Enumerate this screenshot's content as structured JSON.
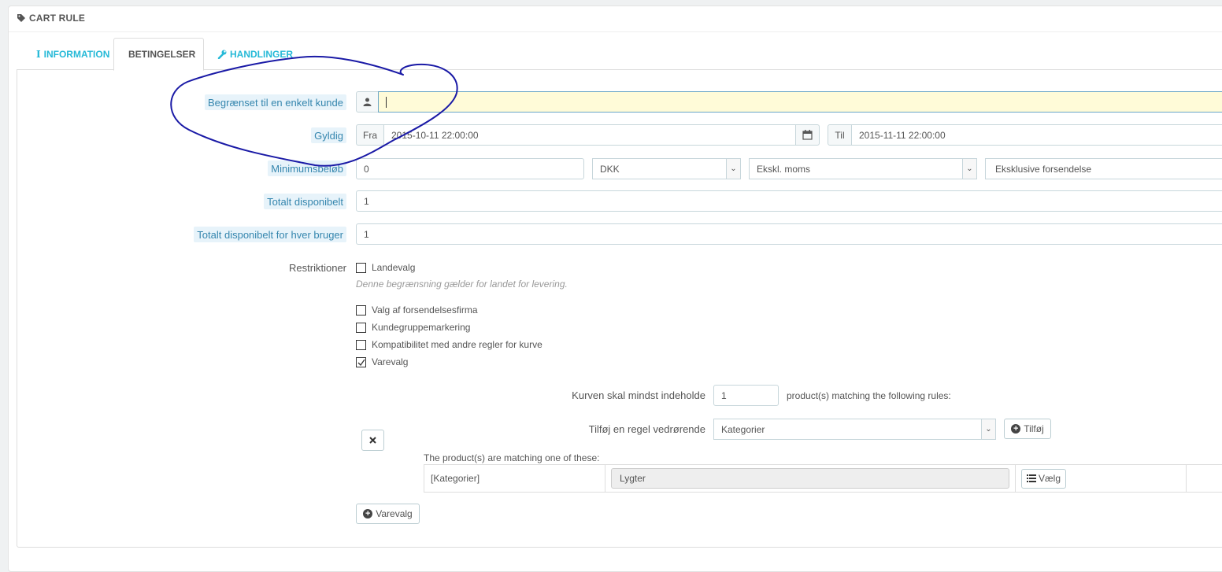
{
  "panel": {
    "title": "CART RULE",
    "icon": "tag-icon"
  },
  "tabs": [
    {
      "label": "INFORMATION",
      "icon": "info-icon",
      "active": false
    },
    {
      "label": "BETINGELSER",
      "icon": "shuffle-icon",
      "active": true
    },
    {
      "label": "HANDLINGER",
      "icon": "wrench-icon",
      "active": false
    }
  ],
  "form": {
    "customer": {
      "label": "Begrænset til en enkelt kunde",
      "value": ""
    },
    "valid": {
      "label": "Gyldig",
      "from_label": "Fra",
      "from_value": "2015-10-11 22:00:00",
      "to_label": "Til",
      "to_value": "2015-11-11 22:00:00"
    },
    "minimum": {
      "label": "Minimumsbeløb",
      "amount": "0",
      "currency": "DKK",
      "tax": "Ekskl. moms",
      "shipping": "Eksklusive forsendelse"
    },
    "total_available": {
      "label": "Totalt disponibelt",
      "value": "1"
    },
    "total_per_user": {
      "label": "Totalt disponibelt for hver bruger",
      "value": "1"
    },
    "restrictions": {
      "label": "Restriktioner",
      "country": {
        "label": "Landevalg",
        "checked": false
      },
      "country_help": "Denne begrænsning gælder for landet for levering.",
      "carrier": {
        "label": "Valg af forsendelsesfirma",
        "checked": false
      },
      "group": {
        "label": "Kundegruppemarkering",
        "checked": false
      },
      "compat": {
        "label": "Kompatibilitet med andre regler for kurve",
        "checked": false
      },
      "product": {
        "label": "Varevalg",
        "checked": true
      }
    },
    "product_rule": {
      "cart_min_label": "Kurven skal mindst indeholde",
      "cart_min_value": "1",
      "matching_text": "product(s) matching the following rules:",
      "add_rule_label": "Tilføj en regel vedrørende",
      "add_rule_select": "Kategorier",
      "add_button": "Tilføj",
      "matching_one": "The product(s) are matching one of these:",
      "row": {
        "type": "[Kategorier]",
        "value": "Lygter",
        "choose_button": "Vælg"
      },
      "add_product_button": "Varevalg"
    }
  },
  "colors": {
    "accent": "#25b9d7",
    "highlight": "#fffbd8",
    "scribble": "#1a1aa6"
  }
}
